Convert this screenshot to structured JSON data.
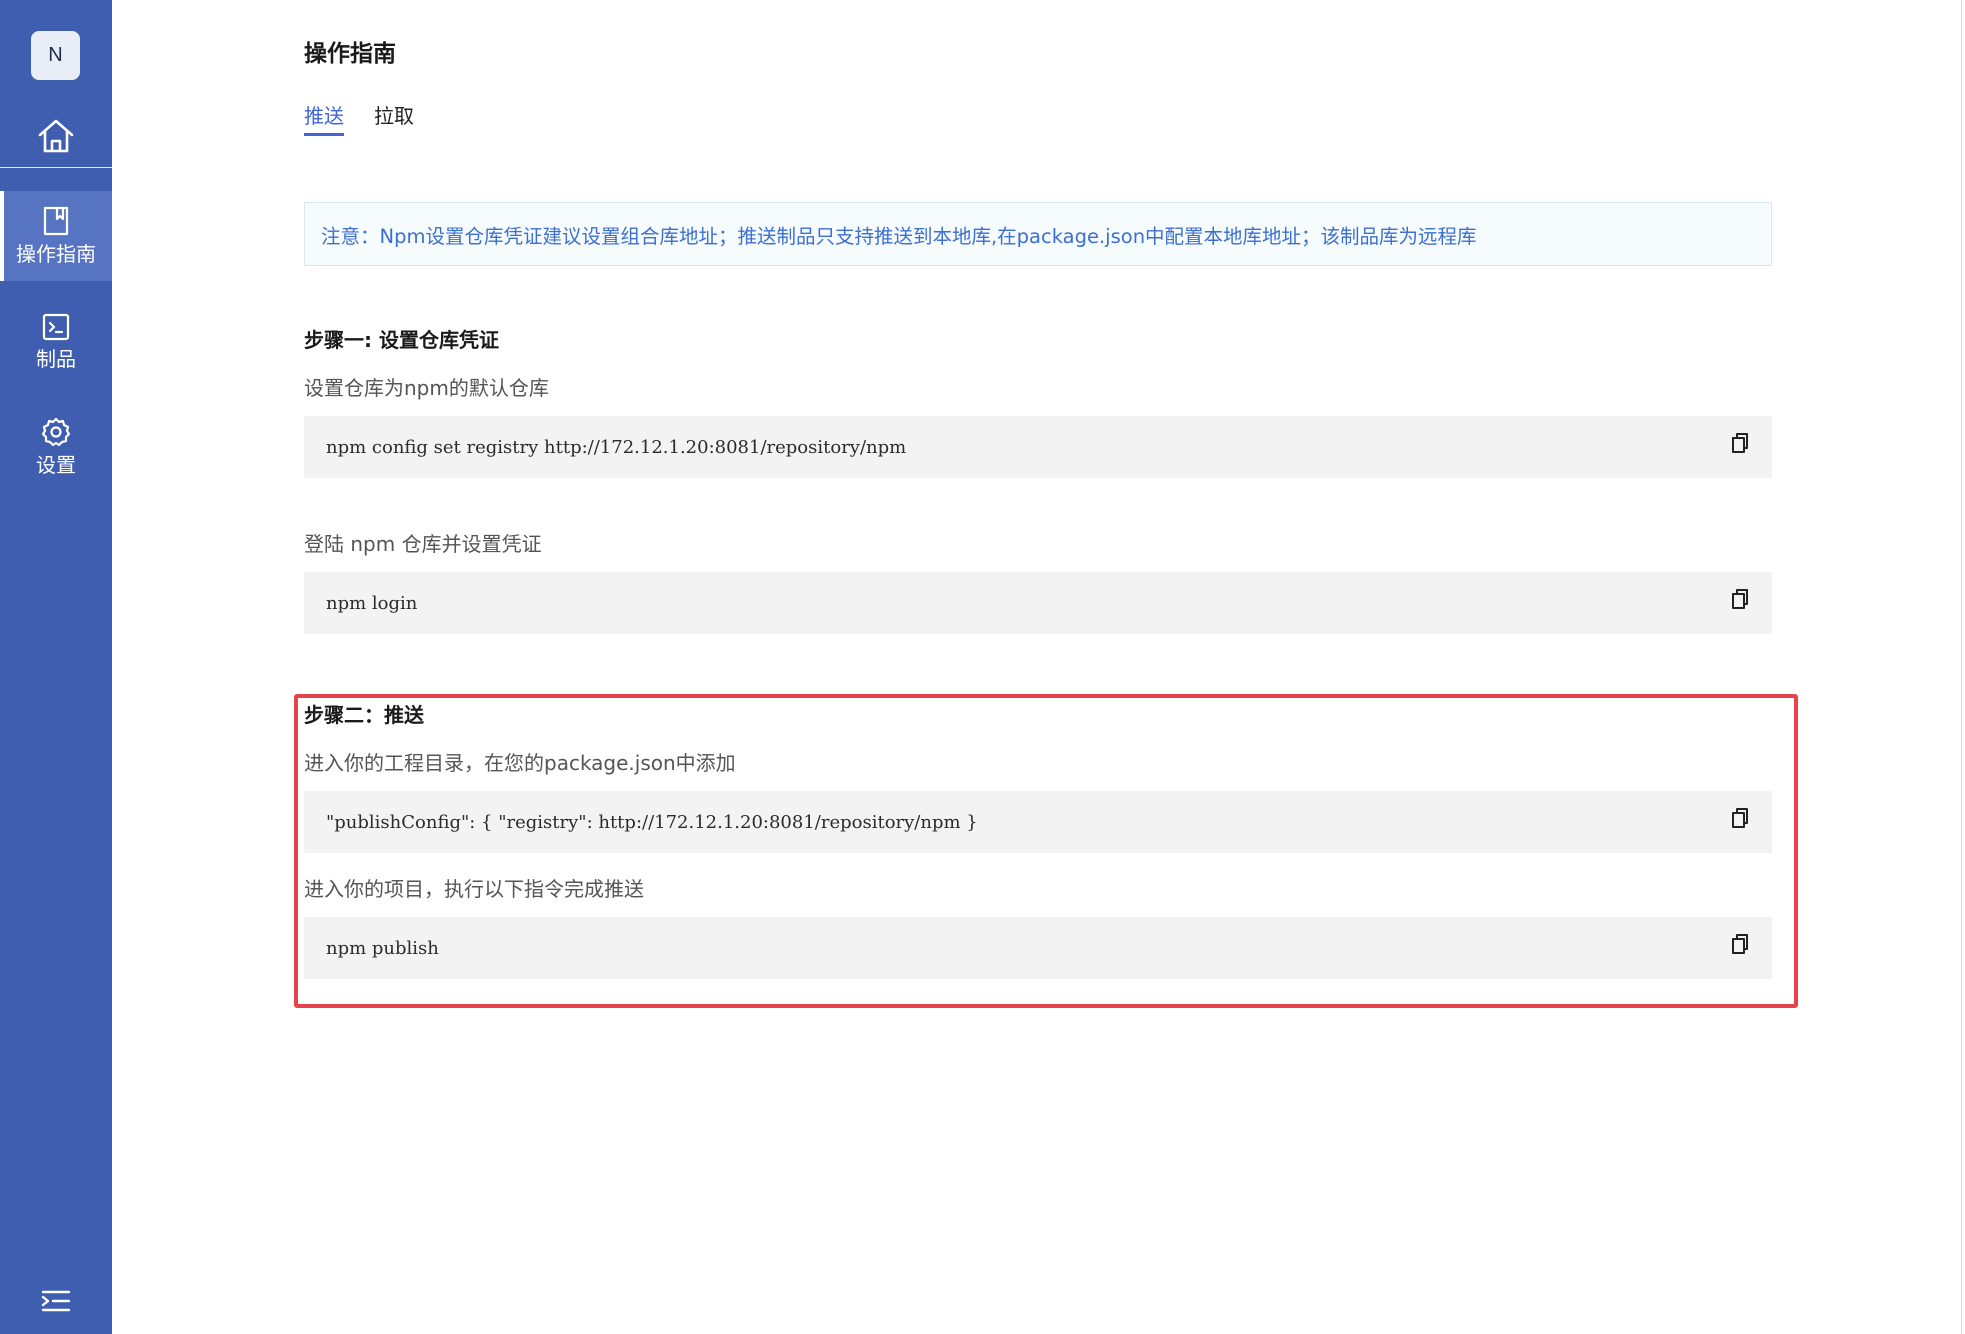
{
  "sidebar": {
    "logo_letter": "N",
    "items": [
      {
        "label": "操作指南",
        "icon": "bookmark-icon",
        "active": true
      },
      {
        "label": "制品",
        "icon": "terminal-icon",
        "active": false
      },
      {
        "label": "设置",
        "icon": "gear-icon",
        "active": false
      }
    ],
    "home_icon": "home-icon",
    "collapse_icon": "menu-collapse-icon",
    "colors": {
      "background": "#3f5eaf",
      "active": "#5674c1"
    }
  },
  "main": {
    "title": "操作指南",
    "tabs": [
      {
        "label": "推送",
        "active": true
      },
      {
        "label": "拉取",
        "active": false
      }
    ],
    "notice": "注意：Npm设置仓库凭证建议设置组合库地址；推送制品只支持推送到本地库,在package.json中配置本地库地址；该制品库为远程库",
    "step1": {
      "title": "步骤一: 设置仓库凭证",
      "desc1": "设置仓库为npm的默认仓库",
      "code1": "npm config set registry http://172.12.1.20:8081/repository/npm",
      "desc2": "登陆 npm 仓库并设置凭证",
      "code2": "npm login"
    },
    "step2": {
      "title": "步骤二：推送",
      "desc1": "进入你的工程目录，在您的package.json中添加",
      "code1": "\"publishConfig\": { \"registry\": http://172.12.1.20:8081/repository/npm }",
      "desc2": "进入你的项目，执行以下指令完成推送",
      "code2": "npm publish"
    },
    "copy_icon": "copy-icon",
    "colors": {
      "accent": "#3f66d6",
      "notice_text": "#3d6fd1",
      "highlight": "#e8434b"
    }
  }
}
